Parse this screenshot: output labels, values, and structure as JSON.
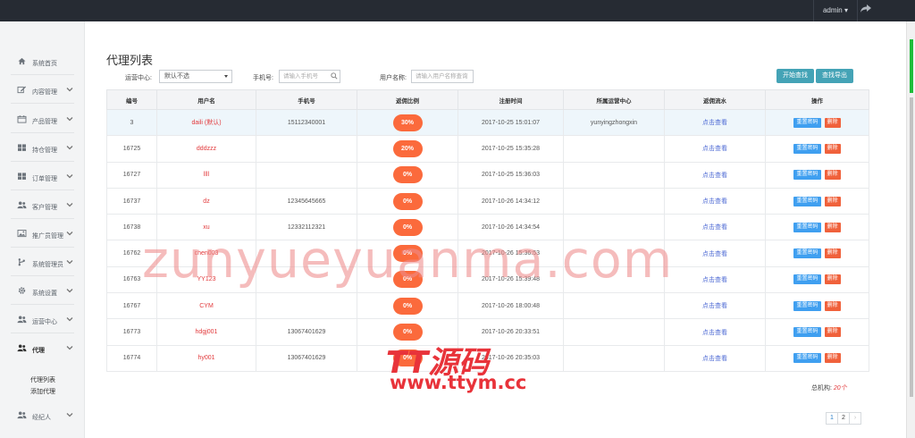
{
  "header": {
    "user": "admin ▾"
  },
  "sidebar": {
    "items": [
      {
        "label": "系统首页",
        "icon": "home-icon",
        "has_chevron": false
      },
      {
        "label": "内容管理",
        "icon": "edit-icon",
        "has_chevron": true
      },
      {
        "label": "产品管理",
        "icon": "calendar-icon",
        "has_chevron": true
      },
      {
        "label": "持仓管理",
        "icon": "grid-icon",
        "has_chevron": true
      },
      {
        "label": "订单管理",
        "icon": "grid-icon",
        "has_chevron": true
      },
      {
        "label": "客户管理",
        "icon": "users-icon",
        "has_chevron": true
      },
      {
        "label": "推广员管理",
        "icon": "image-icon",
        "has_chevron": true
      },
      {
        "label": "系统管理员",
        "icon": "branch-icon",
        "has_chevron": true
      },
      {
        "label": "系统设置",
        "icon": "gear-icon",
        "has_chevron": true
      },
      {
        "label": "运营中心",
        "icon": "users-icon",
        "has_chevron": true
      },
      {
        "label": "代理",
        "icon": "users-icon",
        "has_chevron": true,
        "active": true
      },
      {
        "label": "经纪人",
        "icon": "users-icon",
        "has_chevron": true
      }
    ],
    "agent_sub": [
      "代理列表",
      "添加代理"
    ]
  },
  "page": {
    "title": "代理列表"
  },
  "filters": {
    "center_label": "运营中心:",
    "center_value": "默认不选",
    "phone_label": "手机号:",
    "phone_placeholder": "请输入手机号",
    "name_label": "用户名称:",
    "name_placeholder": "请输入用户名称查询"
  },
  "buttons": {
    "search": "开始查找",
    "export": "查找导出"
  },
  "table": {
    "headers": [
      "编号",
      "用户名",
      "手机号",
      "返佣比例",
      "注册时间",
      "所属运营中心",
      "返佣流水",
      "操作"
    ],
    "rows": [
      {
        "id": "3",
        "name": "daili",
        "tag": "(默认)",
        "phone": "15112340001",
        "ratio": "30%",
        "time": "2017-10-25 15:01:07",
        "center": "yunyingzhongxin",
        "flow": "点击查看"
      },
      {
        "id": "16725",
        "name": "dddzzz",
        "tag": "",
        "phone": "",
        "ratio": "20%",
        "time": "2017-10-25 15:35:28",
        "center": "",
        "flow": "点击查看"
      },
      {
        "id": "16727",
        "name": "llll",
        "tag": "",
        "phone": "",
        "ratio": "0%",
        "time": "2017-10-25 15:36:03",
        "center": "",
        "flow": "点击查看"
      },
      {
        "id": "16737",
        "name": "dz",
        "tag": "",
        "phone": "12345645665",
        "ratio": "0%",
        "time": "2017-10-26 14:34:12",
        "center": "",
        "flow": "点击查看"
      },
      {
        "id": "16738",
        "name": "xu",
        "tag": "",
        "phone": "12332112321",
        "ratio": "0%",
        "time": "2017-10-26 14:34:54",
        "center": "",
        "flow": "点击查看"
      },
      {
        "id": "16762",
        "name": "chen003",
        "tag": "",
        "phone": "",
        "ratio": "0%",
        "time": "2017-10-26 15:36:53",
        "center": "",
        "flow": "点击查看"
      },
      {
        "id": "16763",
        "name": "YY123",
        "tag": "",
        "phone": "",
        "ratio": "0%",
        "time": "2017-10-26 15:39:48",
        "center": "",
        "flow": "点击查看"
      },
      {
        "id": "16767",
        "name": "CYM",
        "tag": "",
        "phone": "",
        "ratio": "0%",
        "time": "2017-10-26 18:00:48",
        "center": "",
        "flow": "点击查看"
      },
      {
        "id": "16773",
        "name": "hdgj001",
        "tag": "",
        "phone": "13067401629",
        "ratio": "0%",
        "time": "2017-10-26 20:33:51",
        "center": "",
        "flow": "点击查看"
      },
      {
        "id": "16774",
        "name": "hy001",
        "tag": "",
        "phone": "13067401629",
        "ratio": "0%",
        "time": "2017-10-26 20:35:03",
        "center": "",
        "flow": "点击查看"
      }
    ],
    "reset_label": "重置密码",
    "delete_label": "删除"
  },
  "summary": {
    "label": "总机构:",
    "count": "20个"
  },
  "pagination": {
    "pages": [
      "1",
      "2"
    ],
    "next": "›"
  },
  "watermark": {
    "main": "zunyueyuanma.com",
    "logo": "TT源码",
    "url": "www.ttym.cc"
  },
  "colors": {
    "topbar": "#262b33",
    "accent": "#44a3b6",
    "ratio_badge": "#fb6a3c",
    "reset": "#3f9ff0",
    "delete": "#f0613b"
  }
}
